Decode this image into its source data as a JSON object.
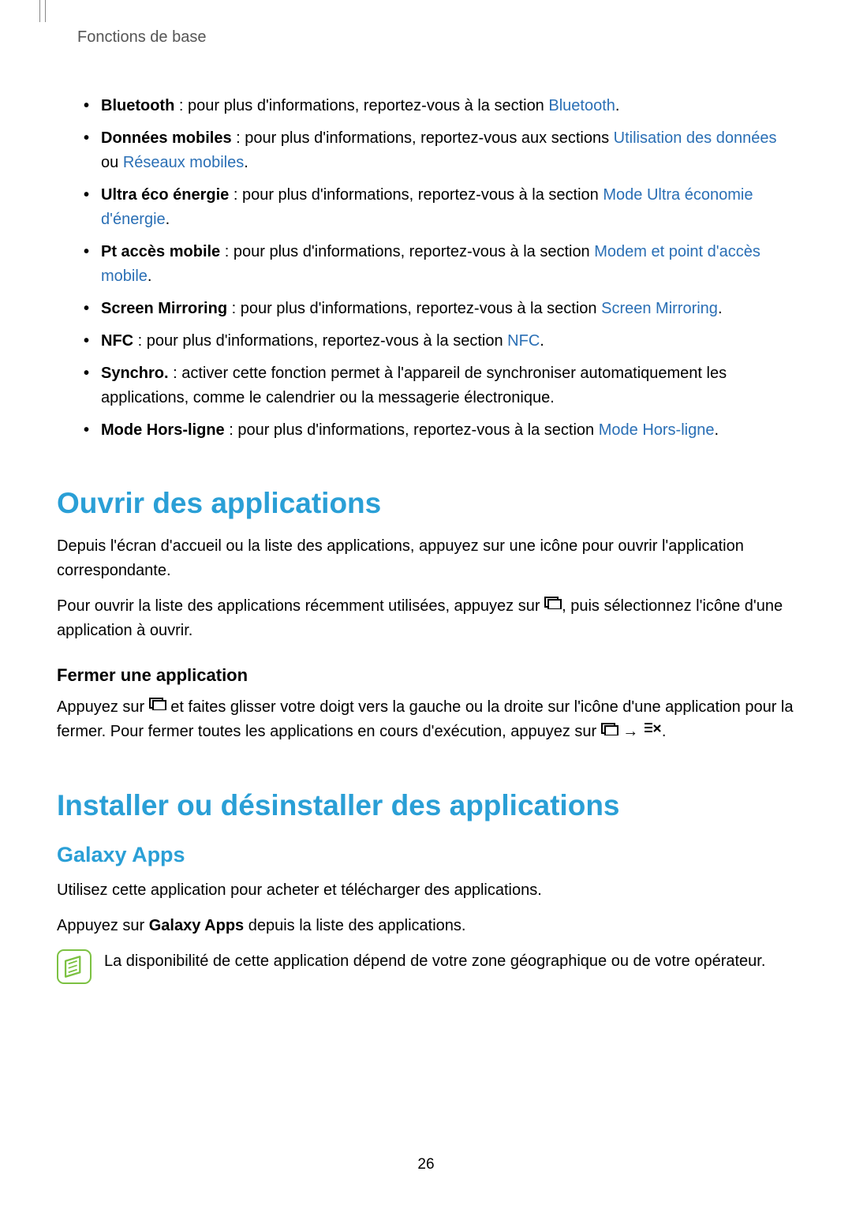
{
  "header": "Fonctions de base",
  "bullets": [
    {
      "label": "Bluetooth",
      "text": " : pour plus d'informations, reportez-vous à la section ",
      "link": "Bluetooth",
      "tail": "."
    },
    {
      "label": "Données mobiles",
      "text": " : pour plus d'informations, reportez-vous aux sections ",
      "link": "Utilisation des données",
      "mid": " ou ",
      "link2": "Réseaux mobiles",
      "tail": "."
    },
    {
      "label": "Ultra éco énergie",
      "text": " : pour plus d'informations, reportez-vous à la section ",
      "link": "Mode Ultra économie d'énergie",
      "tail": "."
    },
    {
      "label": "Pt accès mobile",
      "text": " : pour plus d'informations, reportez-vous à la section ",
      "link": "Modem et point d'accès mobile",
      "tail": "."
    },
    {
      "label": "Screen Mirroring",
      "text": " : pour plus d'informations, reportez-vous à la section ",
      "link": "Screen Mirroring",
      "tail": "."
    },
    {
      "label": "NFC",
      "text": " : pour plus d'informations, reportez-vous à la section ",
      "link": "NFC",
      "tail": "."
    },
    {
      "label": "Synchro.",
      "text": " : activer cette fonction permet à l'appareil de synchroniser automatiquement les applications, comme le calendrier ou la messagerie électronique."
    },
    {
      "label": "Mode Hors-ligne",
      "text": " : pour plus d'informations, reportez-vous à la section ",
      "link": "Mode Hors-ligne",
      "tail": "."
    }
  ],
  "section1": {
    "title": "Ouvrir des applications",
    "p1": "Depuis l'écran d'accueil ou la liste des applications, appuyez sur une icône pour ouvrir l'application correspondante.",
    "p2a": "Pour ouvrir la liste des applications récemment utilisées, appuyez sur ",
    "p2b": ", puis sélectionnez l'icône d'une application à ouvrir.",
    "sub": "Fermer une application",
    "p3a": "Appuyez sur ",
    "p3b": " et faites glisser votre doigt vers la gauche ou la droite sur l'icône d'une application pour la fermer. Pour fermer toutes les applications en cours d'exécution, appuyez sur ",
    "arrow": " → ",
    "p3c": "."
  },
  "section2": {
    "title": "Installer ou désinstaller des applications",
    "sub": "Galaxy Apps",
    "p1": "Utilisez cette application pour acheter et télécharger des applications.",
    "p2a": "Appuyez sur ",
    "p2bold": "Galaxy Apps",
    "p2b": " depuis la liste des applications.",
    "note": "La disponibilité de cette application dépend de votre zone géographique ou de votre opérateur."
  },
  "pageNumber": "26"
}
